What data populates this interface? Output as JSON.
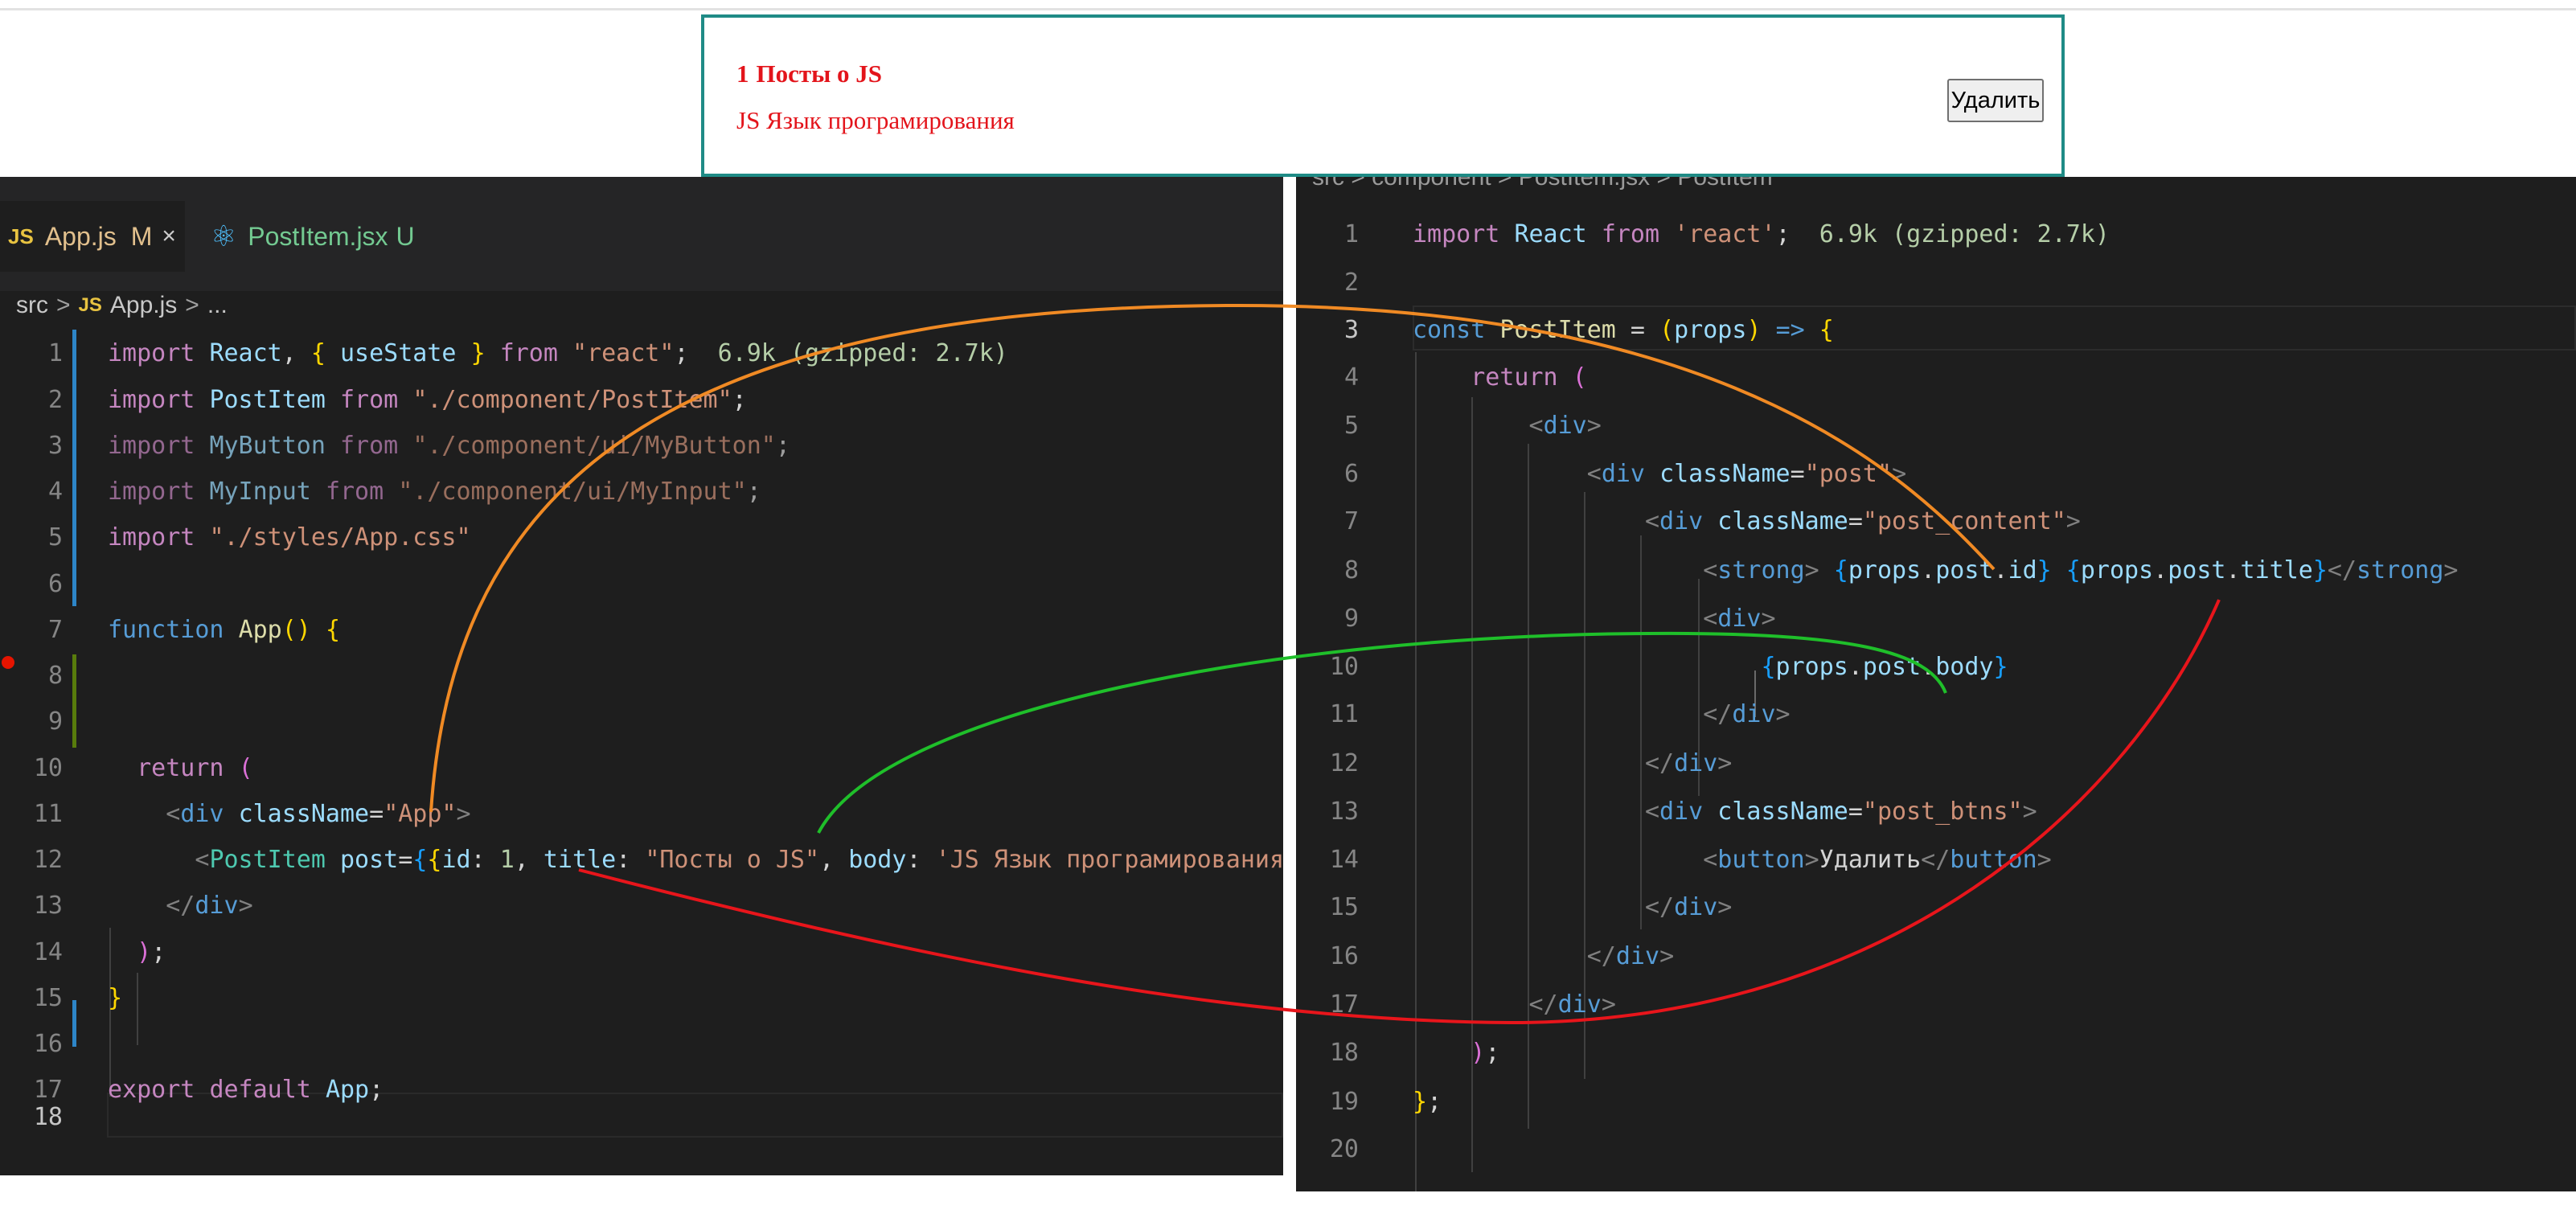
{
  "preview": {
    "post_id": "1",
    "post_title": "Посты о JS",
    "post_body": "JS Язык програмирования",
    "delete_button": "Удалить"
  },
  "left_editor": {
    "tabs": [
      {
        "icon": "JS",
        "label": "App.js",
        "status": "M",
        "close": "×"
      },
      {
        "icon": "react-icon",
        "label": "PostItem.jsx",
        "status": "U"
      }
    ],
    "breadcrumb": {
      "folder": "src",
      "sep": ">",
      "file_icon": "JS",
      "file": "App.js",
      "more": "..."
    },
    "lines": [
      "1",
      "2",
      "3",
      "4",
      "5",
      "6",
      "7",
      "8",
      "9",
      "10",
      "11",
      "12",
      "13",
      "14",
      "15",
      "16",
      "17",
      "18"
    ],
    "import_size": "6.9k (gzipped: 2.7k)"
  },
  "right_editor": {
    "breadcrumb_cut": "src > component > PostItem.jsx > PostItem",
    "lines": [
      "1",
      "2",
      "3",
      "4",
      "5",
      "6",
      "7",
      "8",
      "9",
      "10",
      "11",
      "12",
      "13",
      "14",
      "15",
      "16",
      "17",
      "18",
      "19",
      "20"
    ],
    "import_size": "6.9k (gzipped: 2.7k)"
  },
  "colors": {
    "editor_bg": "#1e1e1e",
    "card_border": "#1f8b86",
    "post_text": "#e3141b",
    "arrow_orange": "#f08a24",
    "arrow_green": "#1fbf2a",
    "arrow_red": "#e8151b"
  }
}
